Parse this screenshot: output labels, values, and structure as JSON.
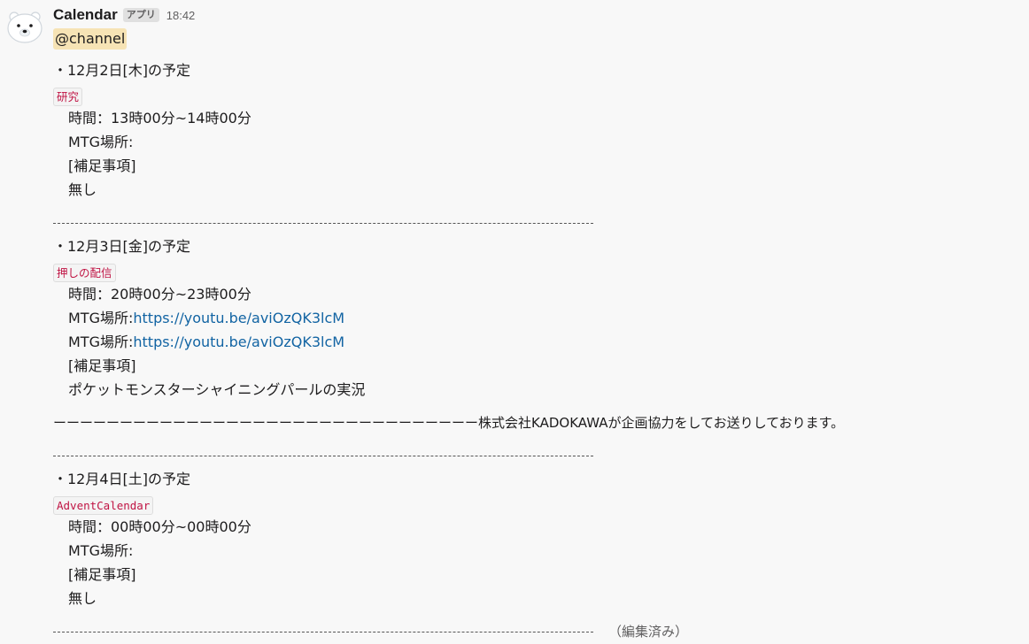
{
  "message": {
    "sender": "Calendar",
    "app_badge": "アプリ",
    "time": "18:42",
    "mention": "@channel",
    "edited": "（編集済み）"
  },
  "events": [
    {
      "title": "・12月2日[木]の予定",
      "tag": "研究",
      "time": "時間：13時00分~14時00分",
      "location_label": "MTG場所:",
      "notes_label": "[補足事項]",
      "notes": "無し"
    },
    {
      "title": "・12月3日[金]の予定",
      "tag": "押しの配信",
      "time": "時間：20時00分~23時00分",
      "location_label": "MTG場所:",
      "location_url": "https://youtu.be/aviOzQK3lcM",
      "location_label_2": "MTG場所:",
      "location_url_2": "https://youtu.be/aviOzQK3lcM",
      "notes_label": "[補足事項]",
      "notes": "ポケットモンスターシャイニングパールの実況",
      "extra": "ーーーーーーーーーーーーーーーーーーーーーーーーーーーーーーーー株式会社KADOKAWAが企画協力をしてお送りしております。"
    },
    {
      "title": "・12月4日[土]の予定",
      "tag": "AdventCalendar",
      "time": "時間：00時00分~00時00分",
      "location_label": "MTG場所:",
      "notes_label": "[補足事項]",
      "notes": "無し"
    }
  ]
}
